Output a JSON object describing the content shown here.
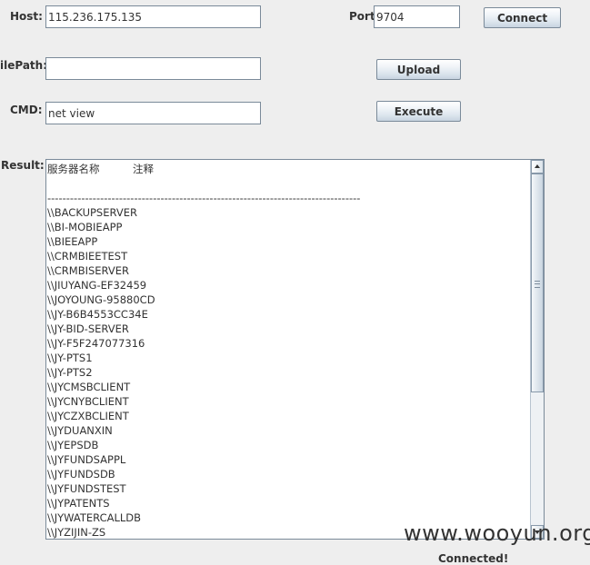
{
  "form": {
    "host_label": "Host:",
    "host_value": "115.236.175.135",
    "port_label": "Port:",
    "port_value": "9704",
    "connect_label": "Connect",
    "filepath_label": "ilePath:",
    "filepath_value": "",
    "upload_label": "Upload",
    "cmd_label": "CMD:",
    "cmd_value": "net view",
    "execute_label": "Execute",
    "result_label": "Result:"
  },
  "result": {
    "lines": [
      "服务器名称          注释",
      "",
      "-----------------------------------------------------------------------------------",
      "\\\\BACKUPSERVER",
      "\\\\BI-MOBIEAPP",
      "\\\\BIEEAPP",
      "\\\\CRMBIEETEST",
      "\\\\CRMBISERVER",
      "\\\\JIUYANG-EF32459",
      "\\\\JOYOUNG-95880CD",
      "\\\\JY-B6B4553CC34E",
      "\\\\JY-BID-SERVER",
      "\\\\JY-F5F247077316",
      "\\\\JY-PTS1",
      "\\\\JY-PTS2",
      "\\\\JYCMSBCLIENT",
      "\\\\JYCNYBCLIENT",
      "\\\\JYCZXBCLIENT",
      "\\\\JYDUANXIN",
      "\\\\JYEPSDB",
      "\\\\JYFUNDSAPPL",
      "\\\\JYFUNDSDB",
      "\\\\JYFUNDSTEST",
      "\\\\JYPATENTS",
      "\\\\JYWATERCALLDB",
      "\\\\JYZIJIN-ZS"
    ]
  },
  "status_text": "Connected!",
  "watermark": "www.wooyun.org",
  "scrollbar": {
    "up_icon": "arrow-up-icon",
    "down_icon": "arrow-down-icon",
    "thumb_icon": "grip-icon"
  },
  "colors": {
    "background": "#eeeeee",
    "field_border": "#7a8a99",
    "text": "#333333"
  }
}
